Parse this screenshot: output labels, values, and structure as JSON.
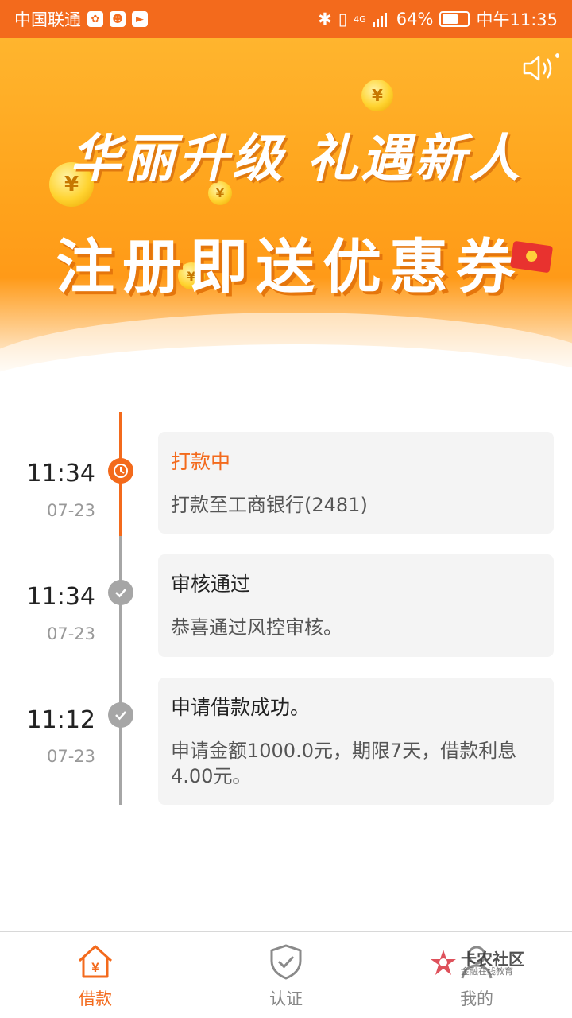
{
  "status_bar": {
    "carrier": "中国联通",
    "network": "4G",
    "battery_percent": "64%",
    "battery_level": 0.64,
    "time": "中午11:35",
    "icons": [
      "app-notification-icon",
      "app-notification-icon",
      "app-notification-icon",
      "bluetooth-icon",
      "vibrate-icon",
      "signal-icon",
      "battery-icon"
    ]
  },
  "banner": {
    "line1": "华丽升级 礼遇新人",
    "line2": "注册即送优惠券",
    "slide_count": 2,
    "active_slide": 2
  },
  "timeline": [
    {
      "time": "11:34",
      "date": "07-23",
      "title": "打款中",
      "description": "打款至工商银行(2481)",
      "status": "in-progress",
      "icon": "clock-icon"
    },
    {
      "time": "11:34",
      "date": "07-23",
      "title": "审核通过",
      "description": "恭喜通过风控审核。",
      "status": "done",
      "icon": "check-icon"
    },
    {
      "time": "11:12",
      "date": "07-23",
      "title": "申请借款成功。",
      "description": "申请金额1000.0元，期限7天，借款利息4.00元。",
      "status": "done",
      "icon": "check-icon"
    }
  ],
  "bottom_nav": {
    "items": [
      {
        "label": "借款",
        "icon": "loan-house-icon",
        "active": true
      },
      {
        "label": "认证",
        "icon": "shield-check-icon",
        "active": false
      },
      {
        "label": "我的",
        "icon": "user-icon",
        "active": false
      }
    ]
  },
  "watermark": {
    "title": "卡农社区",
    "subtitle": "金融在线教育"
  },
  "colors": {
    "accent": "#f36a1c",
    "banner": "#ffa41c",
    "inactive": "#a6a6a6",
    "card": "#f4f4f4"
  }
}
